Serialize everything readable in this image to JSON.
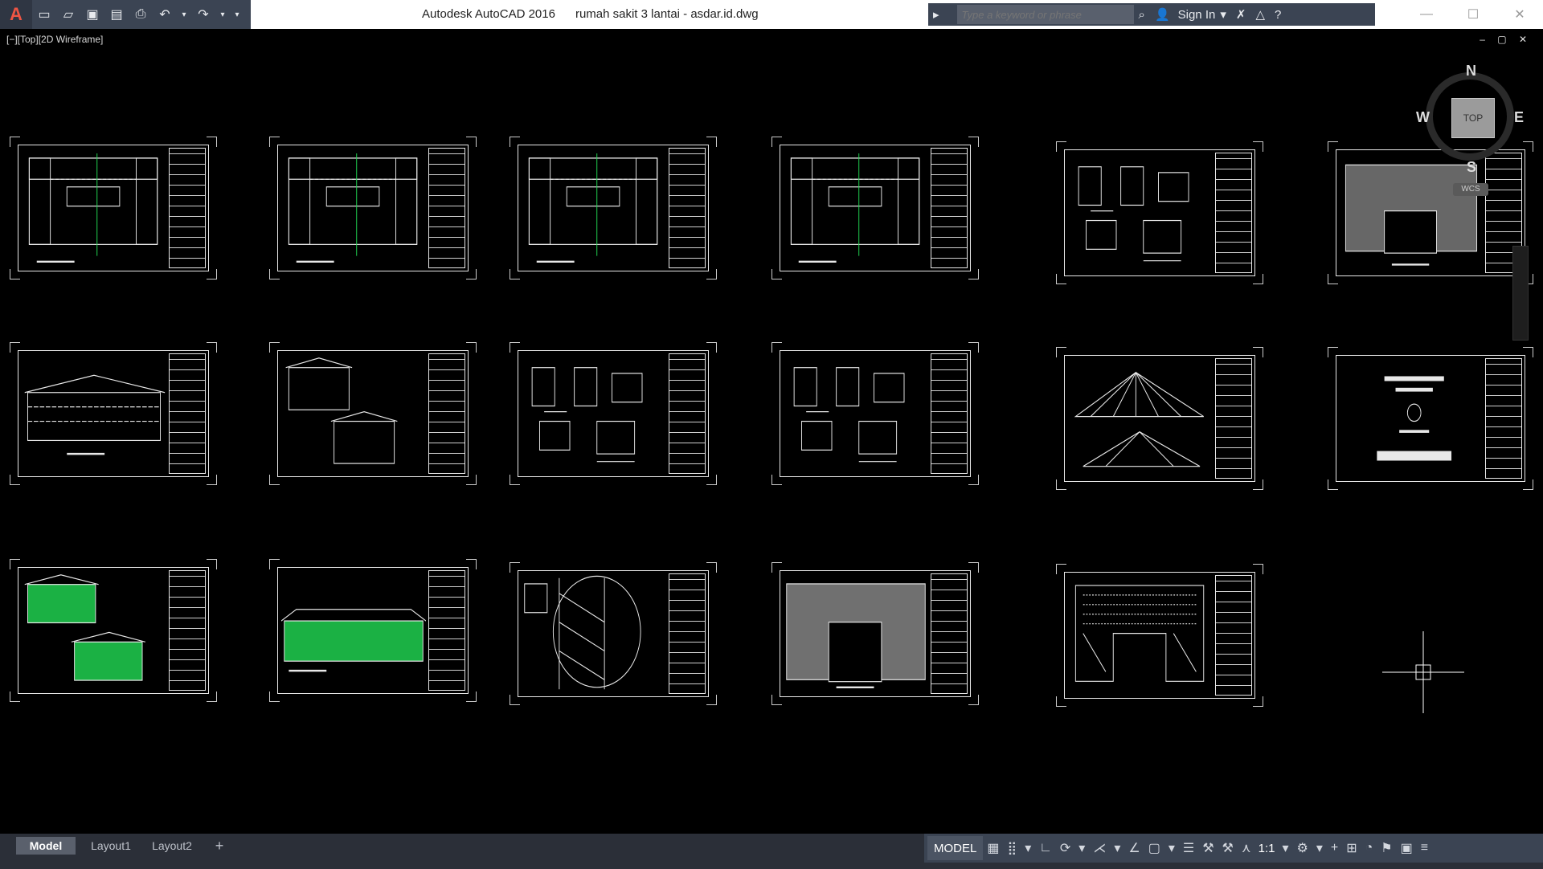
{
  "app": {
    "logo_glyph": "A",
    "title_program": "Autodesk AutoCAD 2016",
    "title_file": "rumah sakit 3 lantai - asdar.id.dwg",
    "title_full": "Autodesk AutoCAD 2016      rumah sakit 3 lantai - asdar.id.dwg"
  },
  "quick_access": [
    {
      "name": "new",
      "glyph": "▭"
    },
    {
      "name": "open",
      "glyph": "▱"
    },
    {
      "name": "save",
      "glyph": "▣"
    },
    {
      "name": "save-as",
      "glyph": "▤"
    },
    {
      "name": "plot",
      "glyph": "⎙"
    },
    {
      "name": "undo",
      "glyph": "↶"
    },
    {
      "name": "redo",
      "glyph": "↷"
    }
  ],
  "search": {
    "placeholder": "Type a keyword or phrase",
    "sign_in": "Sign In"
  },
  "window_controls": {
    "minimize": "—",
    "maximize": "☐",
    "close": "✕"
  },
  "viewport": {
    "label": "[−][Top][2D Wireframe]",
    "controls": "– ▢ ✕"
  },
  "viewcube": {
    "top": "TOP",
    "n": "N",
    "s": "S",
    "e": "E",
    "w": "W",
    "wcs": "WCS"
  },
  "sheets": [
    {
      "kind": "plan"
    },
    {
      "kind": "plan"
    },
    {
      "kind": "plan"
    },
    {
      "kind": "plan"
    },
    {
      "kind": "details"
    },
    {
      "kind": "roofplan"
    },
    {
      "kind": "elevation"
    },
    {
      "kind": "section"
    },
    {
      "kind": "details"
    },
    {
      "kind": "details"
    },
    {
      "kind": "truss"
    },
    {
      "kind": "cover"
    },
    {
      "kind": "greenelev"
    },
    {
      "kind": "greenelev2"
    },
    {
      "kind": "stair"
    },
    {
      "kind": "hatchplan"
    },
    {
      "kind": "framing"
    }
  ],
  "layout_tabs": {
    "model": "Model",
    "layout1": "Layout1",
    "layout2": "Layout2",
    "add": "+"
  },
  "statusbar": {
    "model": "MODEL",
    "scale": "1:1"
  },
  "colors": {
    "titlebar_dark": "#3b4453",
    "drawing_line": "#e8e8e8",
    "accent_green": "#22dd55",
    "background": "#000000"
  }
}
